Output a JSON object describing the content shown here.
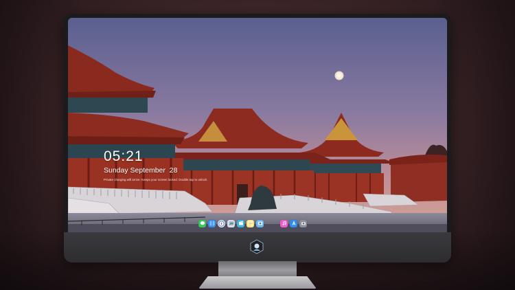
{
  "lock_screen": {
    "time": "05:21",
    "date": "Sunday September  28",
    "message": "Private charging will arrive: Keeps your screen locked. Double tap to unlock"
  },
  "dock": {
    "apps": [
      {
        "name": "messages",
        "color": "#34c759"
      },
      {
        "name": "finder",
        "color": "#2f8cf0"
      },
      {
        "name": "safari",
        "color": "#e9e9ee"
      },
      {
        "name": "preview",
        "color": "#cfd8e4"
      },
      {
        "name": "final-cut",
        "color": "#3bb5e0"
      },
      {
        "name": "notes",
        "color": "#f7d85a"
      },
      {
        "name": "photo-browser",
        "color": "#6cb5e8"
      },
      {
        "name": "music",
        "color": "#f05bd0"
      },
      {
        "name": "app-store",
        "color": "#2f8cf0"
      },
      {
        "name": "screenshot",
        "color": "#8a8f98"
      }
    ]
  },
  "colors": {
    "sky_top": "#5e6392",
    "sky_bottom": "#c48a8a",
    "roof": "#8a2d22",
    "wall": "#9c3324",
    "moon": "#f4efe3"
  }
}
